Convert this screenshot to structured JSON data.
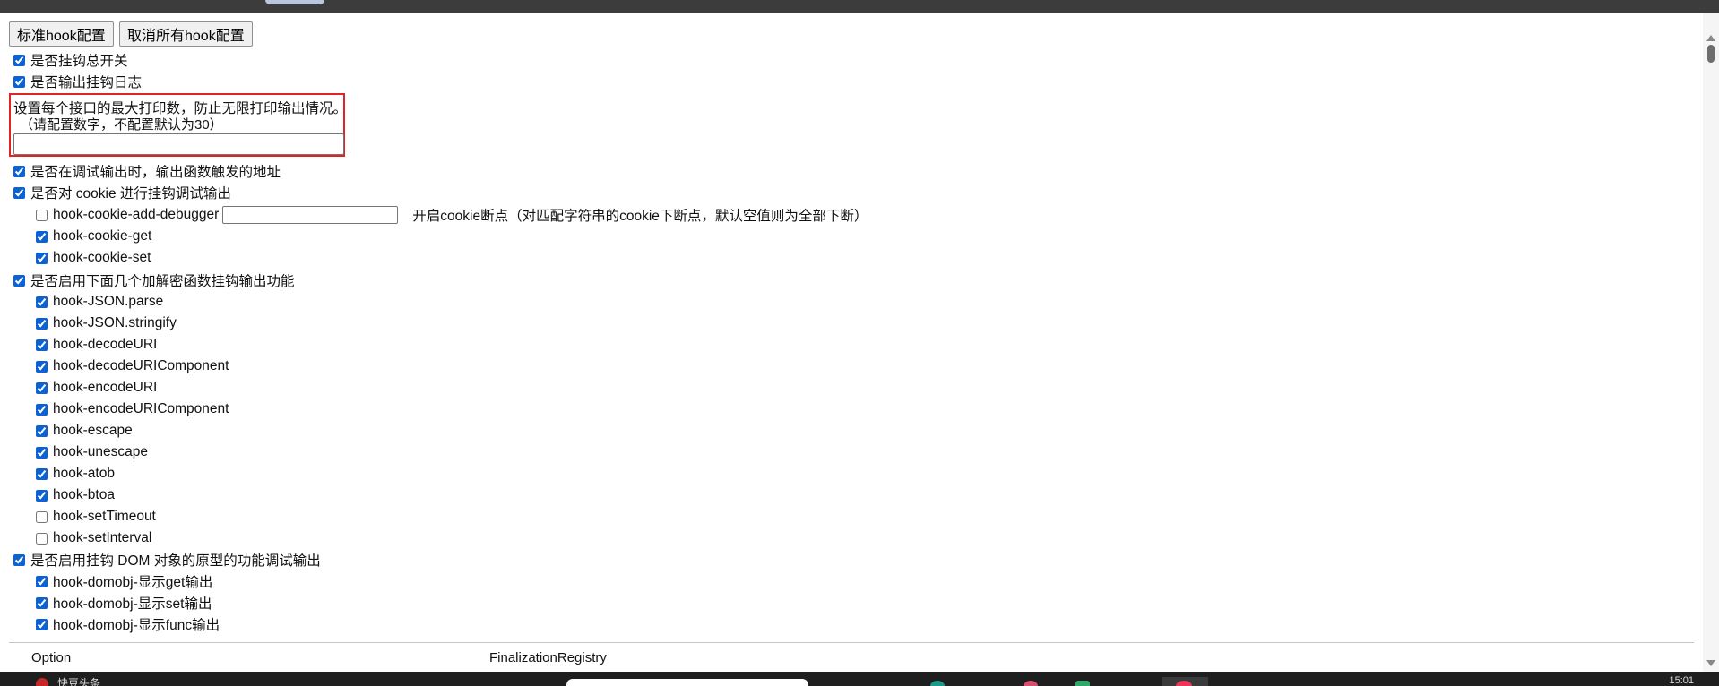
{
  "buttons": {
    "standard": "标准hook配置",
    "cancel_all": "取消所有hook配置"
  },
  "options": {
    "master_switch": {
      "label": "是否挂钩总开关",
      "checked": true
    },
    "log_output": {
      "label": "是否输出挂钩日志",
      "checked": true
    },
    "max_print": {
      "line1": "设置每个接口的最大打印数，防止无限打印输出情况。",
      "line2": "（请配置数字，不配置默认为30）",
      "value": ""
    },
    "debug_addr": {
      "label": "是否在调试输出时，输出函数触发的地址",
      "checked": true
    },
    "cookie_hook": {
      "label": "是否对 cookie 进行挂钩调试输出",
      "checked": true
    }
  },
  "cookie": {
    "add_debugger": {
      "label": "hook-cookie-add-debugger",
      "checked": false,
      "value": "",
      "hint": "开启cookie断点（对匹配字符串的cookie下断点，默认空值则为全部下断）"
    },
    "items": [
      {
        "label": "hook-cookie-get",
        "checked": true
      },
      {
        "label": "hook-cookie-set",
        "checked": true
      }
    ]
  },
  "crypto": {
    "header": {
      "label": "是否启用下面几个加解密函数挂钩输出功能",
      "checked": true
    },
    "items": [
      {
        "label": "hook-JSON.parse",
        "checked": true
      },
      {
        "label": "hook-JSON.stringify",
        "checked": true
      },
      {
        "label": "hook-decodeURI",
        "checked": true
      },
      {
        "label": "hook-decodeURIComponent",
        "checked": true
      },
      {
        "label": "hook-encodeURI",
        "checked": true
      },
      {
        "label": "hook-encodeURIComponent",
        "checked": true
      },
      {
        "label": "hook-escape",
        "checked": true
      },
      {
        "label": "hook-unescape",
        "checked": true
      },
      {
        "label": "hook-atob",
        "checked": true
      },
      {
        "label": "hook-btoa",
        "checked": true
      },
      {
        "label": "hook-setTimeout",
        "checked": false
      },
      {
        "label": "hook-setInterval",
        "checked": false
      }
    ]
  },
  "dom": {
    "header": {
      "label": "是否启用挂钩 DOM 对象的原型的功能调试输出",
      "checked": true
    },
    "items": [
      {
        "label": "hook-domobj-显示get输出",
        "checked": true
      },
      {
        "label": "hook-domobj-显示set输出",
        "checked": true
      },
      {
        "label": "hook-domobj-显示func输出",
        "checked": true
      }
    ]
  },
  "footer": {
    "col1": "Option",
    "col2": "FinalizationRegistry"
  },
  "taskbar": {
    "badge": "7",
    "text": "快豆头条",
    "time": "15:01"
  },
  "colors": {
    "highlight_border": "#e02424",
    "checkbox_accent": "#0b62d4",
    "topbar": "#3c3c3c"
  }
}
